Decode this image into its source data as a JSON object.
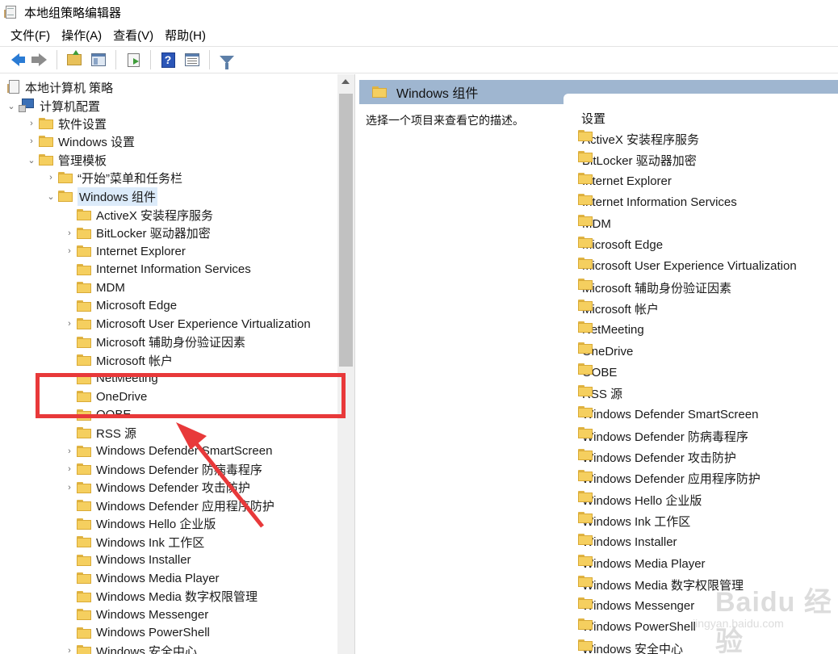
{
  "window": {
    "title": "本地组策略编辑器",
    "app_icon": "group-policy-icon"
  },
  "menu": [
    "文件(F)",
    "操作(A)",
    "查看(V)",
    "帮助(H)"
  ],
  "toolbar": [
    "back-icon",
    "forward-icon",
    "up-folder-icon",
    "show-hide-tree-icon",
    "export-list-icon",
    "help-icon",
    "properties-icon",
    "filter-icon"
  ],
  "tree": {
    "root": "本地计算机 策略",
    "computer_config": "计算机配置",
    "software_settings": "软件设置",
    "windows_settings": "Windows 设置",
    "admin_templates": "管理模板",
    "start_menu": "“开始”菜单和任务栏",
    "windows_components": "Windows 组件",
    "children": [
      "ActiveX 安装程序服务",
      "BitLocker 驱动器加密",
      "Internet Explorer",
      "Internet Information Services",
      "MDM",
      "Microsoft Edge",
      "Microsoft User Experience Virtualization",
      "Microsoft 辅助身份验证因素",
      "Microsoft 帐户",
      "NetMeeting",
      "OneDrive",
      "OOBE",
      "RSS 源",
      "Windows Defender SmartScreen",
      "Windows Defender 防病毒程序",
      "Windows Defender 攻击防护",
      "Windows Defender 应用程序防护",
      "Windows Hello 企业版",
      "Windows Ink 工作区",
      "Windows Installer",
      "Windows Media Player",
      "Windows Media 数字权限管理",
      "Windows Messenger",
      "Windows PowerShell",
      "Windows 安全中心"
    ]
  },
  "right": {
    "header": "Windows 组件",
    "description": "选择一个项目来查看它的描述。",
    "column_header": "设置",
    "items": [
      "ActiveX 安装程序服务",
      "BitLocker 驱动器加密",
      "Internet Explorer",
      "Internet Information Services",
      "MDM",
      "Microsoft Edge",
      "Microsoft User Experience Virtualization",
      "Microsoft 辅助身份验证因素",
      "Microsoft 帐户",
      "NetMeeting",
      "OneDrive",
      "OOBE",
      "RSS 源",
      "Windows Defender SmartScreen",
      "Windows Defender 防病毒程序",
      "Windows Defender 攻击防护",
      "Windows Defender 应用程序防护",
      "Windows Hello 企业版",
      "Windows Ink 工作区",
      "Windows Installer",
      "Windows Media Player",
      "Windows Media 数字权限管理",
      "Windows Messenger",
      "Windows PowerShell",
      "Windows 安全中心"
    ]
  },
  "annotation": {
    "highlight_target": "OneDrive",
    "color": "#e8393a"
  },
  "watermark": {
    "text": "Baidu 经验",
    "sub": "jingyan.baidu.com"
  },
  "colors": {
    "header_bg": "#9fb6d0",
    "selected_bg": "#dcebfa",
    "folder": "#f5cf5f"
  }
}
